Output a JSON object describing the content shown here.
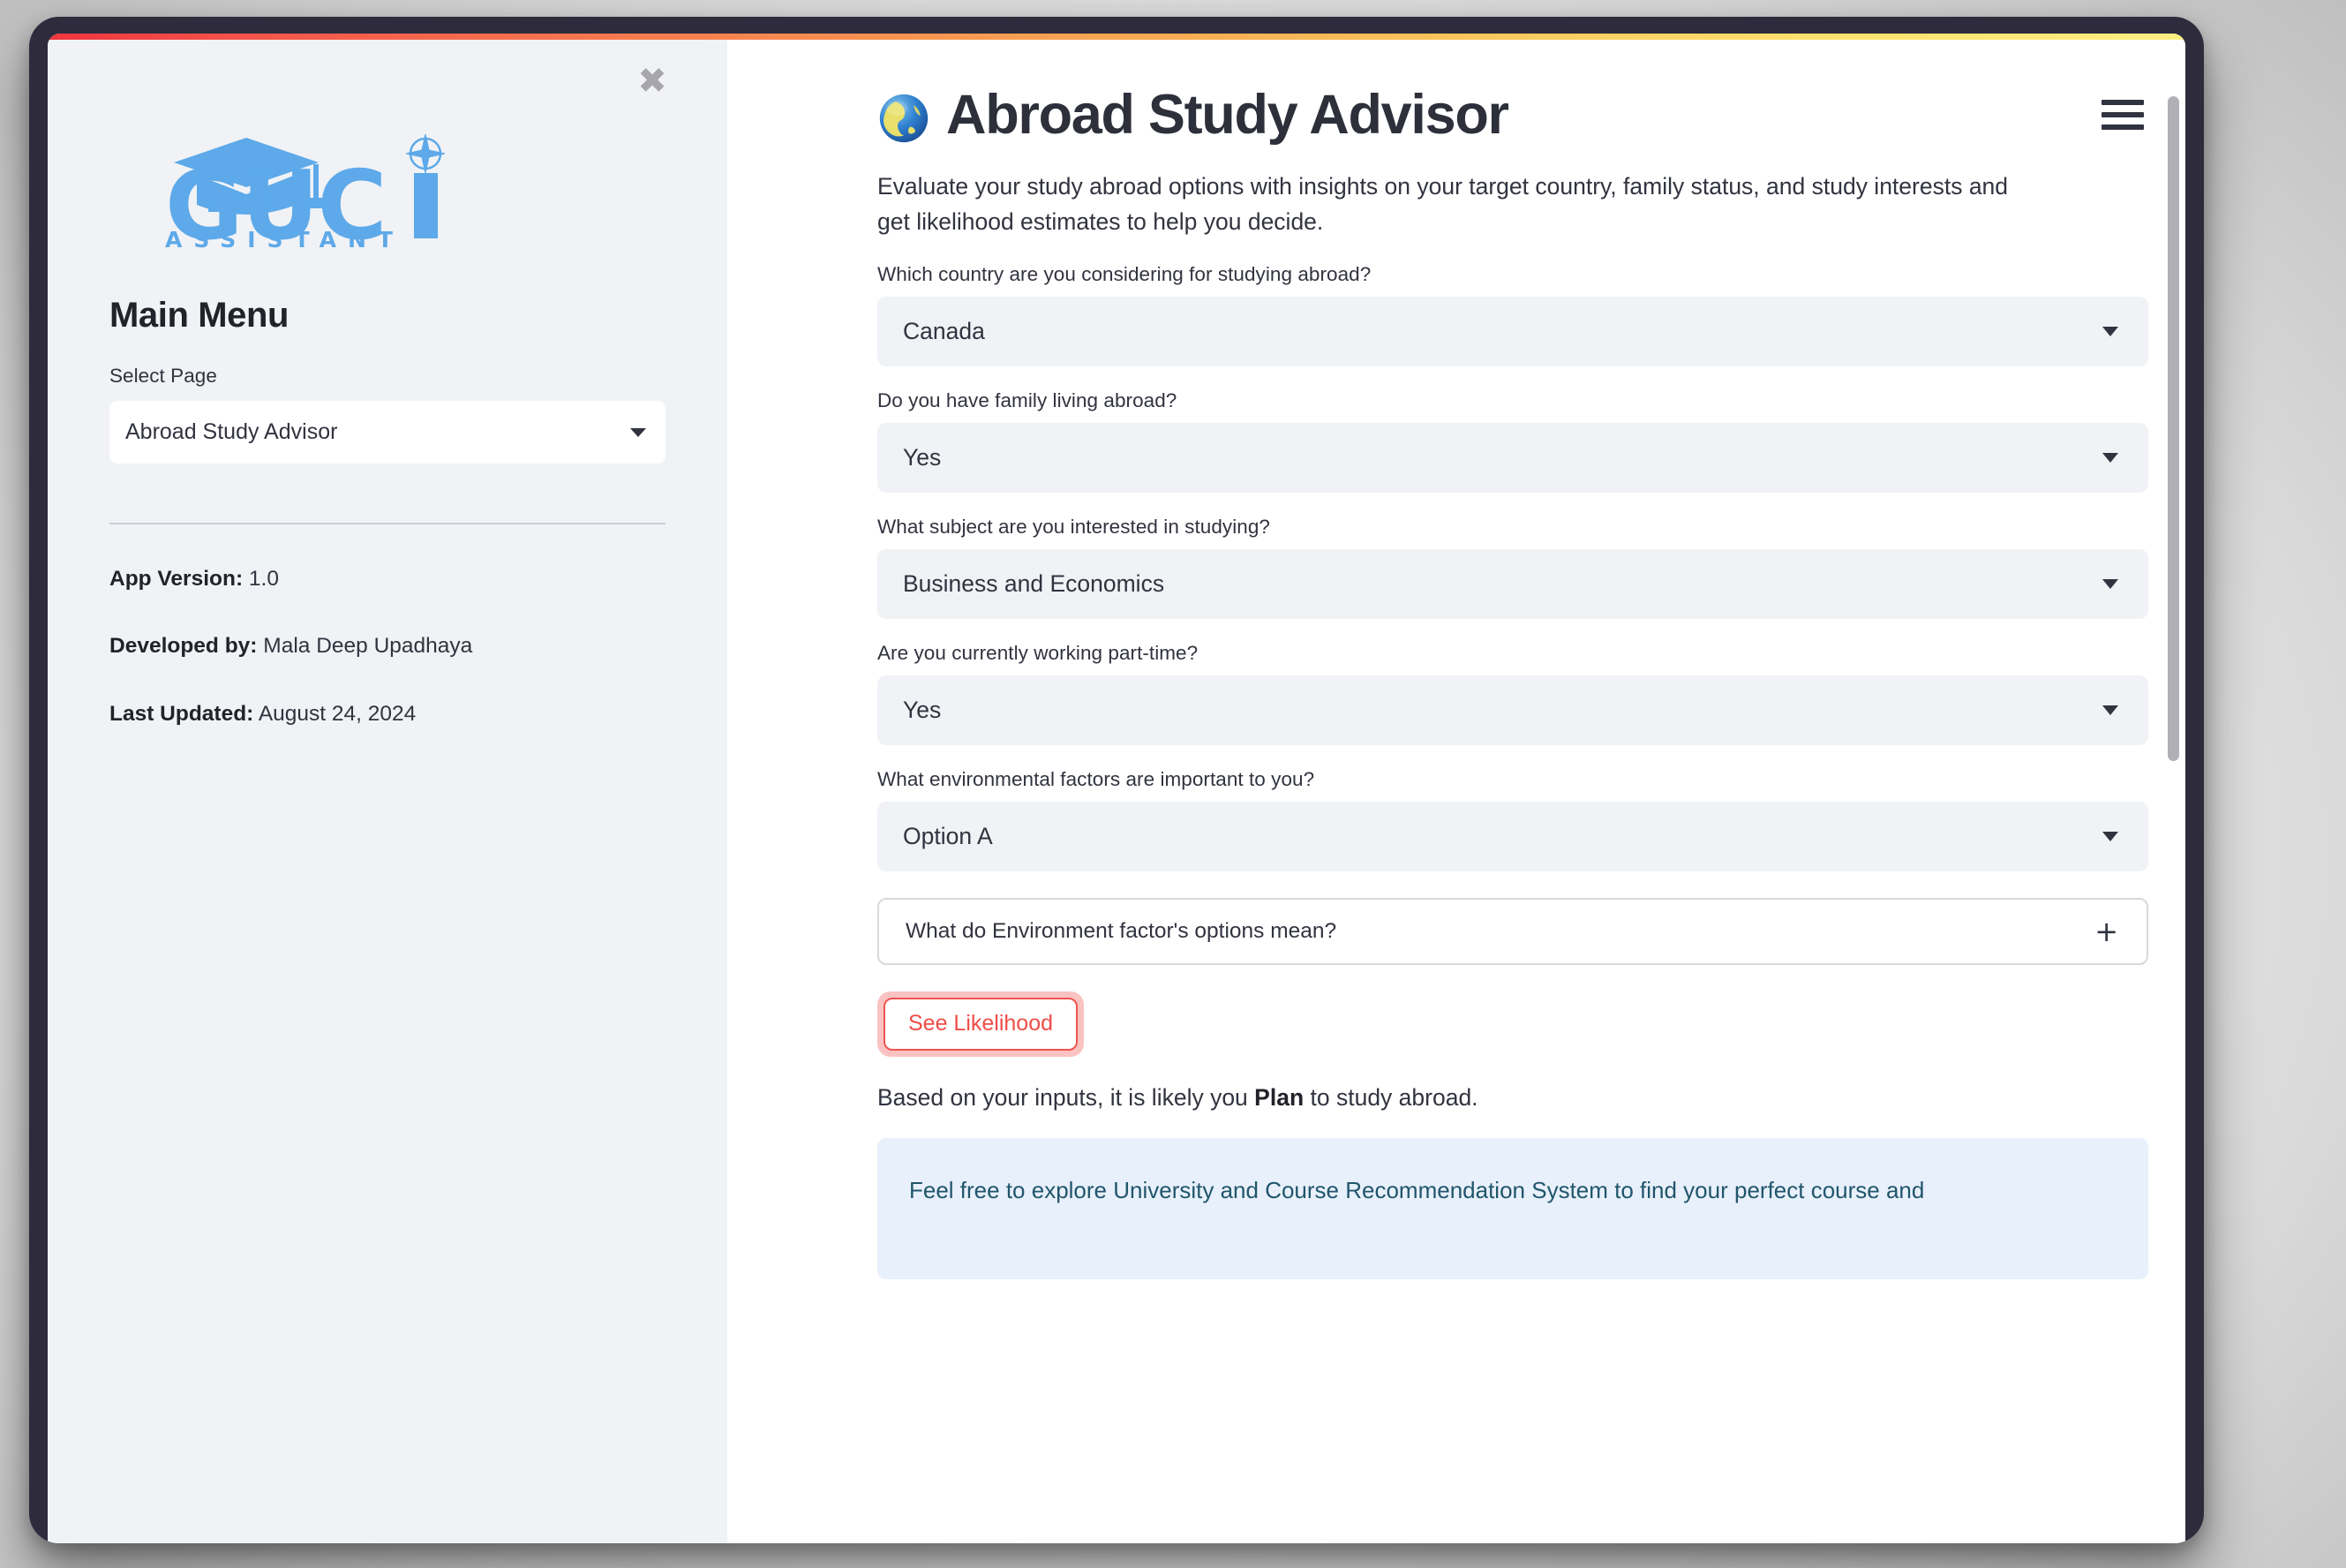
{
  "window": {
    "frame_color": "#2e2b3d",
    "top_gradient": [
      "#f0353f",
      "#f9a752",
      "#fdee82"
    ]
  },
  "sidebar": {
    "close_icon_label": "✖",
    "logo": {
      "wordmark": "GUCI",
      "tagline": "A S S I S T A N T",
      "color": "#5da9e9"
    },
    "heading": "Main Menu",
    "select_page_label": "Select Page",
    "page_select": {
      "value": "Abroad Study Advisor",
      "options": [
        "Abroad Study Advisor"
      ]
    },
    "meta": [
      {
        "label": "App Version:",
        "value": "1.0"
      },
      {
        "label": "Developed by:",
        "value": "Mala Deep Upadhaya"
      },
      {
        "label": "Last Updated:",
        "value": "August 24, 2024"
      }
    ]
  },
  "main": {
    "menu_icon": "hamburger-icon",
    "title_emoji": "🌍",
    "title": "Abroad Study Advisor",
    "description": "Evaluate your study abroad options with insights on your target country, family status, and study interests and get likelihood estimates to help you decide.",
    "fields": [
      {
        "label": "Which country are you considering for studying abroad?",
        "value": "Canada",
        "name": "country-select"
      },
      {
        "label": "Do you have family living abroad?",
        "value": "Yes",
        "name": "family-abroad-select"
      },
      {
        "label": "What subject are you interested in studying?",
        "value": "Business and Economics",
        "name": "subject-select"
      },
      {
        "label": "Are you currently working part-time?",
        "value": "Yes",
        "name": "part-time-work-select"
      },
      {
        "label": "What environmental factors are important to you?",
        "value": "Option A",
        "name": "environment-factor-select"
      }
    ],
    "expander": {
      "label": "What do Environment factor's options mean?",
      "toggle_icon": "+"
    },
    "submit_button": {
      "label": "See Likelihood",
      "border_color": "#ef5350",
      "text_color": "#ef4d48"
    },
    "result": {
      "prefix": "Based on your inputs, it is likely you ",
      "emphasis": "Plan",
      "suffix": " to study abroad."
    },
    "info_box": {
      "text": "Feel free to explore University and Course Recommendation System to find your perfect course and",
      "background": "#e8f0fb",
      "text_color": "#20566b"
    }
  }
}
